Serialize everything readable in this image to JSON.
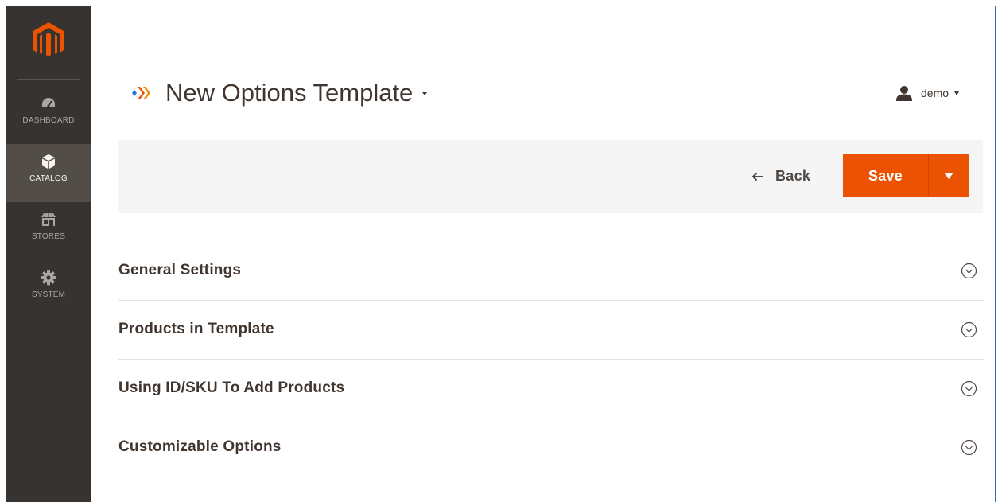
{
  "sidebar": {
    "logo": "magento-logo",
    "items": [
      {
        "label": "DASHBOARD",
        "icon": "dashboard-gauge-icon",
        "active": false
      },
      {
        "label": "CATALOG",
        "icon": "catalog-box-icon",
        "active": true
      },
      {
        "label": "STORES",
        "icon": "stores-shop-icon",
        "active": false
      },
      {
        "label": "SYSTEM",
        "icon": "system-gear-icon",
        "active": false
      }
    ]
  },
  "header": {
    "title": "New Options Template",
    "title_icon": "mageworx-logo-icon",
    "user": {
      "name": "demo",
      "icon": "user-icon"
    }
  },
  "actions": {
    "back_label": "Back",
    "save_label": "Save"
  },
  "sections": [
    {
      "title": "General Settings"
    },
    {
      "title": "Products in Template"
    },
    {
      "title": "Using ID/SKU To Add Products"
    },
    {
      "title": "Customizable Options"
    }
  ],
  "colors": {
    "sidebar_bg": "#373330",
    "sidebar_active_bg": "#524d49",
    "accent": "#eb5202",
    "text": "#41362f",
    "action_bar_bg": "#f5f5f5",
    "frame_border": "#2f6fb8"
  }
}
